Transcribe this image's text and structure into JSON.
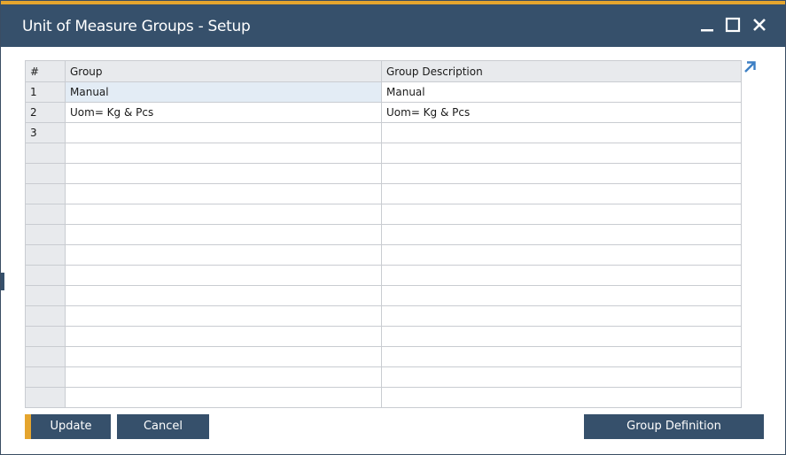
{
  "window": {
    "title": "Unit of Measure Groups - Setup",
    "accent_color": "#e5a52e",
    "titlebar_color": "#36506b"
  },
  "controls": {
    "minimize_icon": "minimize-icon",
    "maximize_icon": "maximize-icon",
    "close_icon": "close-icon"
  },
  "grid": {
    "columns": [
      "#",
      "Group",
      "Group Description"
    ],
    "rows": [
      {
        "num": "1",
        "group": "Manual",
        "description": "Manual"
      },
      {
        "num": "2",
        "group": "Uom= Kg & Pcs",
        "description": "Uom= Kg & Pcs"
      },
      {
        "num": "3",
        "group": "",
        "description": ""
      },
      {
        "num": "",
        "group": "",
        "description": ""
      },
      {
        "num": "",
        "group": "",
        "description": ""
      },
      {
        "num": "",
        "group": "",
        "description": ""
      },
      {
        "num": "",
        "group": "",
        "description": ""
      },
      {
        "num": "",
        "group": "",
        "description": ""
      },
      {
        "num": "",
        "group": "",
        "description": ""
      },
      {
        "num": "",
        "group": "",
        "description": ""
      },
      {
        "num": "",
        "group": "",
        "description": ""
      },
      {
        "num": "",
        "group": "",
        "description": ""
      },
      {
        "num": "",
        "group": "",
        "description": ""
      },
      {
        "num": "",
        "group": "",
        "description": ""
      },
      {
        "num": "",
        "group": "",
        "description": ""
      },
      {
        "num": "",
        "group": "",
        "description": ""
      }
    ]
  },
  "buttons": {
    "update": "Update",
    "cancel": "Cancel",
    "group_definition": "Group Definition"
  }
}
